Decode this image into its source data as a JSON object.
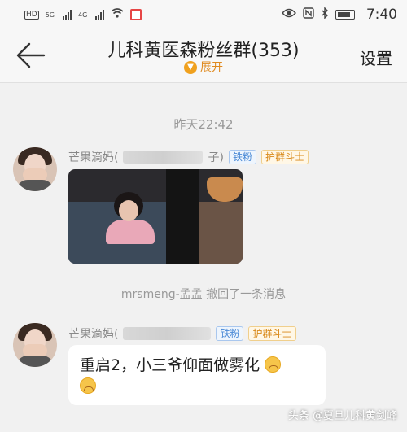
{
  "status_bar": {
    "hd_label_1": "HD",
    "hd_label_2": "HD",
    "net_1": "5G",
    "net_2": "4G",
    "time": "7:40"
  },
  "header": {
    "title": "儿科黄医森粉丝群(353)",
    "expand_label": "展开",
    "settings_label": "设置"
  },
  "chat": {
    "timestamp": "昨天22:42",
    "messages": [
      {
        "sender_visible": "芒果滴妈(",
        "sender_tail": "子)",
        "badges": [
          "铁粉",
          "护群斗士"
        ],
        "type": "image"
      },
      {
        "sender_visible": "芒果滴妈(",
        "badges": [
          "铁粉",
          "护群斗士"
        ],
        "type": "text",
        "text": "重启2，小三爷仰面做雾化"
      }
    ],
    "recall_notice": "mrsmeng-孟孟 撤回了一条消息"
  },
  "watermark": "头条 @夏旦儿科黄剑峰",
  "colors": {
    "accent_orange": "#e08a1e",
    "badge_blue": "#4b8ad6",
    "background": "#f1f1f1"
  },
  "icons": [
    "back-arrow-icon",
    "expand-chevron-icon",
    "eye-icon",
    "nfc-icon",
    "bluetooth-icon",
    "battery-icon",
    "wifi-icon",
    "cry-emoji-icon"
  ]
}
